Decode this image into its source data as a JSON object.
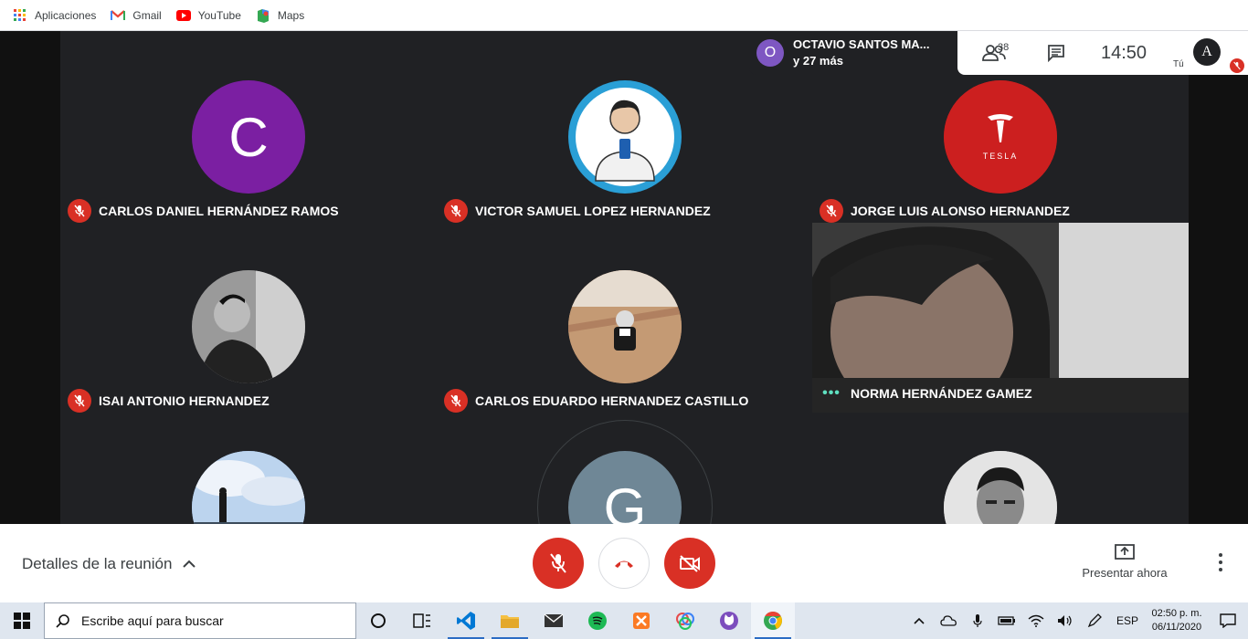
{
  "bookmarks": [
    {
      "label": "Aplicaciones",
      "icon": "apps-grid-icon"
    },
    {
      "label": "Gmail",
      "icon": "gmail-icon"
    },
    {
      "label": "YouTube",
      "icon": "youtube-icon"
    },
    {
      "label": "Maps",
      "icon": "maps-icon"
    }
  ],
  "top_bar": {
    "presenter_initial": "O",
    "presenter_name": "OCTAVIO SANTOS MA...",
    "presenter_more": "y 27 más",
    "participants_count": "38",
    "time": "14:50",
    "self_label": "Tú",
    "self_initial": "A"
  },
  "participants": [
    {
      "name": "CARLOS DANIEL HERNÁNDEZ RAMOS",
      "initial": "C",
      "avatar_color": "#7b1fa2",
      "muted": true
    },
    {
      "name": "VICTOR SAMUEL LOPEZ HERNANDEZ",
      "initial": "",
      "avatar_color": "#2a9fd6",
      "muted": true
    },
    {
      "name": "JORGE LUIS ALONSO HERNANDEZ",
      "initial": "",
      "avatar_color": "#cc1f1f",
      "muted": true,
      "logo_text": "TESLA"
    },
    {
      "name": "ISAI ANTONIO HERNANDEZ",
      "initial": "",
      "avatar_color": "#444444",
      "muted": true
    },
    {
      "name": "CARLOS EDUARDO HERNANDEZ CASTILLO",
      "initial": "",
      "avatar_color": "#b38a6a",
      "muted": true
    },
    {
      "name": "NORMA HERNÁNDEZ GAMEZ",
      "initial": "",
      "avatar_color": "#6b6b6b",
      "muted": false
    },
    {
      "name": "",
      "initial": "",
      "avatar_color": "#7fa8d8",
      "muted": true
    },
    {
      "name": "",
      "initial": "G",
      "avatar_color": "#6f8796",
      "muted": true
    },
    {
      "name": "",
      "initial": "",
      "avatar_color": "#cfcfcf",
      "muted": true
    }
  ],
  "bottom_bar": {
    "meeting_details": "Detalles de la reunión",
    "present_now": "Presentar ahora"
  },
  "taskbar": {
    "search_placeholder": "Escribe aquí para buscar",
    "language": "ESP",
    "time": "02:50 p. m.",
    "date": "06/11/2020"
  },
  "colors": {
    "danger": "#d93025",
    "meet_bg": "#202124"
  }
}
